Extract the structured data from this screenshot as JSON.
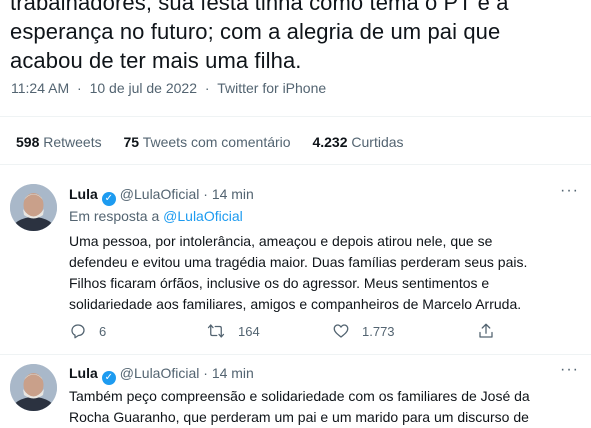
{
  "tweet": {
    "text_lines": [
      "trabalhadores, sua festa tinha como tema o PT e a",
      "esperança no futuro; com a alegria de um pai que",
      "acabou de ter mais uma filha."
    ],
    "time": "11:24 AM",
    "date": "10 de jul de 2022",
    "source": "Twitter for iPhone",
    "separator": "·"
  },
  "stats": {
    "retweets_count": "598",
    "retweets_label": "Retweets",
    "quotes_count": "75",
    "quotes_label": "Tweets com comentário",
    "likes_count": "4.232",
    "likes_label": "Curtidas"
  },
  "replies": [
    {
      "name": "Lula",
      "handle": "@LulaOficial",
      "time": "14 min",
      "reply_to_label": "Em resposta a",
      "reply_to_handle": "@LulaOficial",
      "body_lines": [
        "Uma pessoa, por intolerância, ameaçou e depois atirou nele, que se",
        "defendeu e evitou uma tragédia maior. Duas famílias perderam seus pais.",
        "Filhos ficaram órfãos, inclusive os do agressor. Meus sentimentos e",
        "solidariedade aos familiares, amigos e companheiros de Marcelo Arruda."
      ],
      "reply_count": "6",
      "retweet_count": "164",
      "like_count": "1.773"
    },
    {
      "name": "Lula",
      "handle": "@LulaOficial",
      "time": "14 min",
      "body_lines": [
        "Também peço compreensão e solidariedade com os familiares de José da",
        "Rocha Guaranho, que perderam um pai e um marido para um discurso de"
      ]
    }
  ],
  "icons": {
    "verified": "verified-badge-icon",
    "more": "more-icon",
    "reply": "reply-icon",
    "retweet": "retweet-icon",
    "like": "like-icon",
    "share": "share-icon"
  },
  "colors": {
    "text": "#0f1419",
    "secondary": "#536471",
    "link": "#1d9bf0",
    "divider": "#eff3f4"
  }
}
